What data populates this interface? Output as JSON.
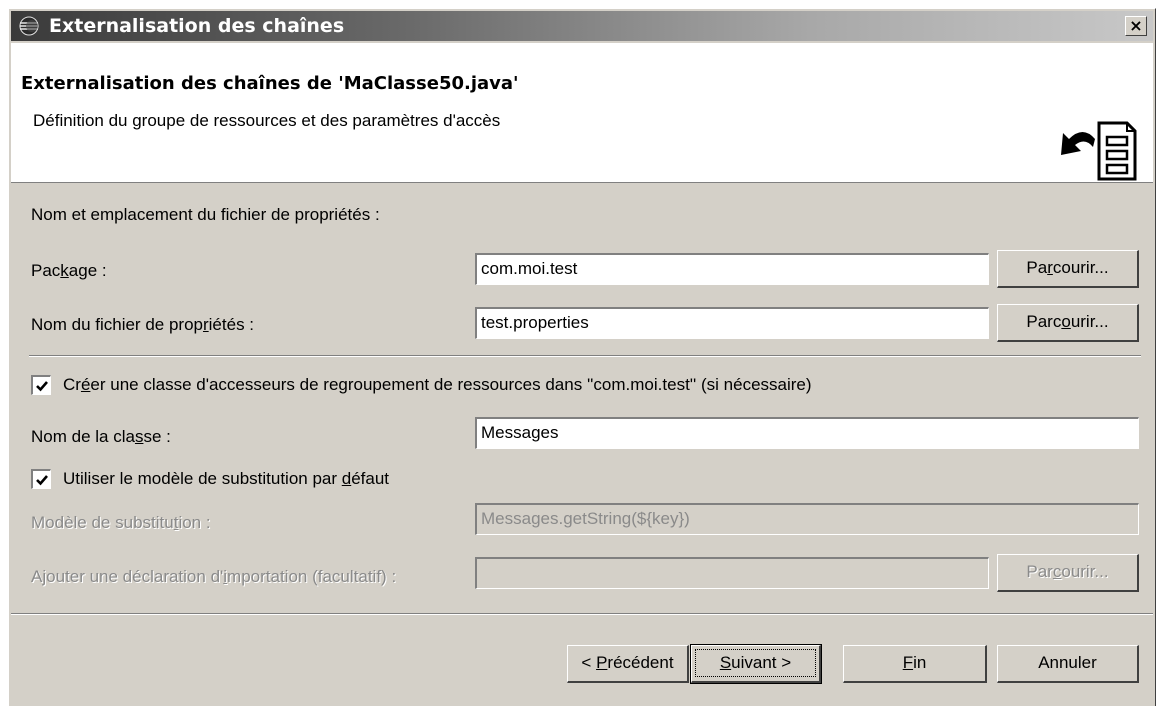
{
  "window": {
    "title": "Externalisation des chaînes",
    "close_label": "×"
  },
  "header": {
    "title": "Externalisation des chaînes de 'MaClasse50.java'",
    "description": "Définition du groupe de ressources et des paramètres d'accès",
    "graphic_icon": "externalize-strings-wizard-icon"
  },
  "form": {
    "section_label": "Nom et emplacement du fichier de propriétés :",
    "package": {
      "label_pre": "Pac",
      "label_ul": "k",
      "label_post": "age :",
      "value": "com.moi.test",
      "browse_pre": "Pa",
      "browse_ul": "r",
      "browse_post": "courir..."
    },
    "properties_file": {
      "label_pre": "Nom du fichier de prop",
      "label_ul": "r",
      "label_post": "iétés :",
      "value": "test.properties",
      "browse_pre": "Parc",
      "browse_ul": "o",
      "browse_post": "urir..."
    },
    "create_accessor": {
      "checked": true,
      "label_pre": "Cr",
      "label_ul": "é",
      "label_post": "er une classe d'accesseurs de regroupement de ressources dans  ''com.moi.test'' (si nécessaire)"
    },
    "class_name": {
      "label_pre": "Nom de la cla",
      "label_ul": "s",
      "label_post": "se :",
      "value": "Messages"
    },
    "default_pattern": {
      "checked": true,
      "label_pre": "Utiliser le modèle de substitution par ",
      "label_ul": "d",
      "label_post": "éfaut"
    },
    "substitution_pattern": {
      "label_pre": "Modèle de substitu",
      "label_ul": "t",
      "label_post": "ion :",
      "value": "Messages.getString(${key})"
    },
    "import_declaration": {
      "label_pre": "Ajouter une déclaration d'",
      "label_ul": "i",
      "label_post": "mportation (facultatif) :",
      "value": "",
      "browse_pre": "Par",
      "browse_ul": "c",
      "browse_post": "ourir..."
    }
  },
  "footer": {
    "back": {
      "pre": "< ",
      "ul": "P",
      "post": "récédent"
    },
    "next": {
      "pre": "",
      "ul": "S",
      "post": "uivant >"
    },
    "finish": {
      "pre": "",
      "ul": "F",
      "post": "in"
    },
    "cancel": "Annuler"
  },
  "colors": {
    "dialog_bg": "#d4d0c8",
    "header_bg": "#ffffff",
    "disabled_text": "#8a8a8a"
  }
}
